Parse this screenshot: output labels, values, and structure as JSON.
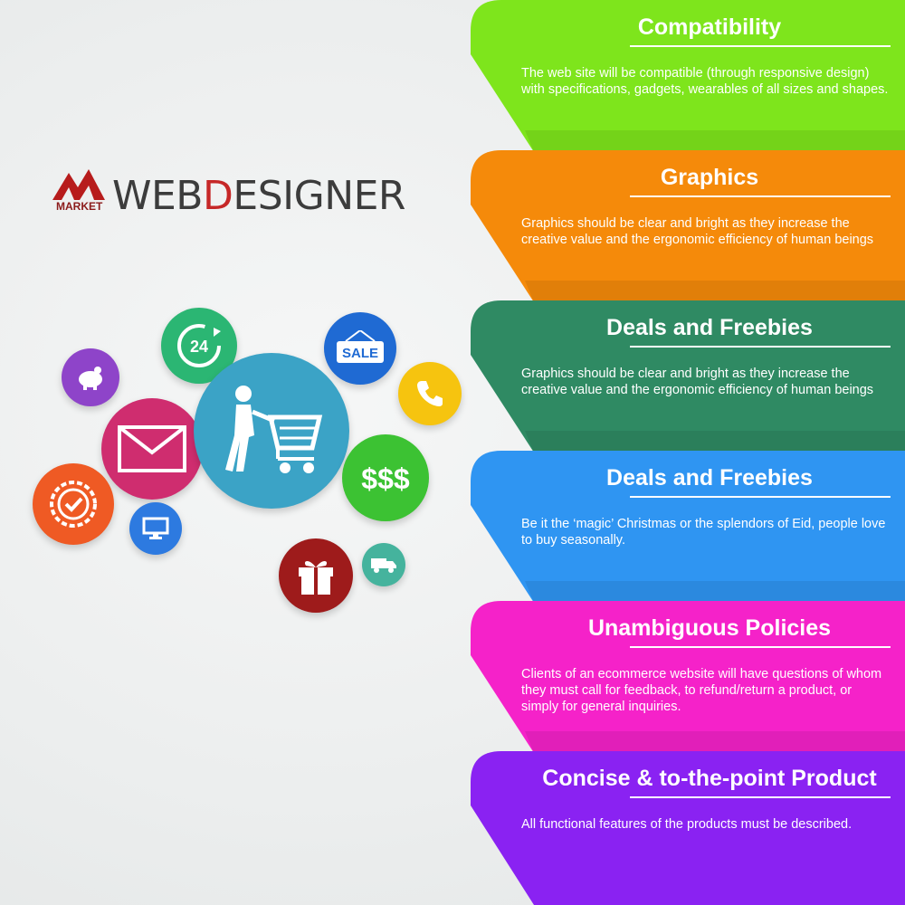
{
  "logo": {
    "market": "MARKET",
    "word_a": "WEB",
    "word_b": "D",
    "word_c": "ESIGNER"
  },
  "icons": {
    "timer_text": "24",
    "sale_text": "SALE",
    "money_text": "$$$"
  },
  "panels": [
    {
      "title": "Compatibility",
      "desc": " The web site will be compatible (through responsive design) with specifications, gadgets, wearables of all sizes and shapes.",
      "color": "#7ee51c"
    },
    {
      "title": "Graphics",
      "desc": "Graphics should be clear and bright as they increase the creative value and the ergonomic efficiency of human beings",
      "color": "#f58a0a"
    },
    {
      "title": "Deals and Freebies",
      "desc": "Graphics should be clear and bright as they increase the creative value and the ergonomic efficiency of human beings",
      "color": "#2f8a63"
    },
    {
      "title": "Deals and Freebies",
      "desc": "Be it the ‘magic’ Christmas or the splendors of Eid, people love to buy seasonally.",
      "color": "#2f95f2"
    },
    {
      "title": "Unambiguous Policies",
      "desc": " Clients of an ecommerce website will have questions of whom they must call for feedback, to refund/return a product, or simply for general inquiries.",
      "color": "#f522c9"
    },
    {
      "title": "Concise & to-the-point Product",
      "desc": "All functional features of the products must be described.",
      "color": "#8a22f2"
    }
  ]
}
